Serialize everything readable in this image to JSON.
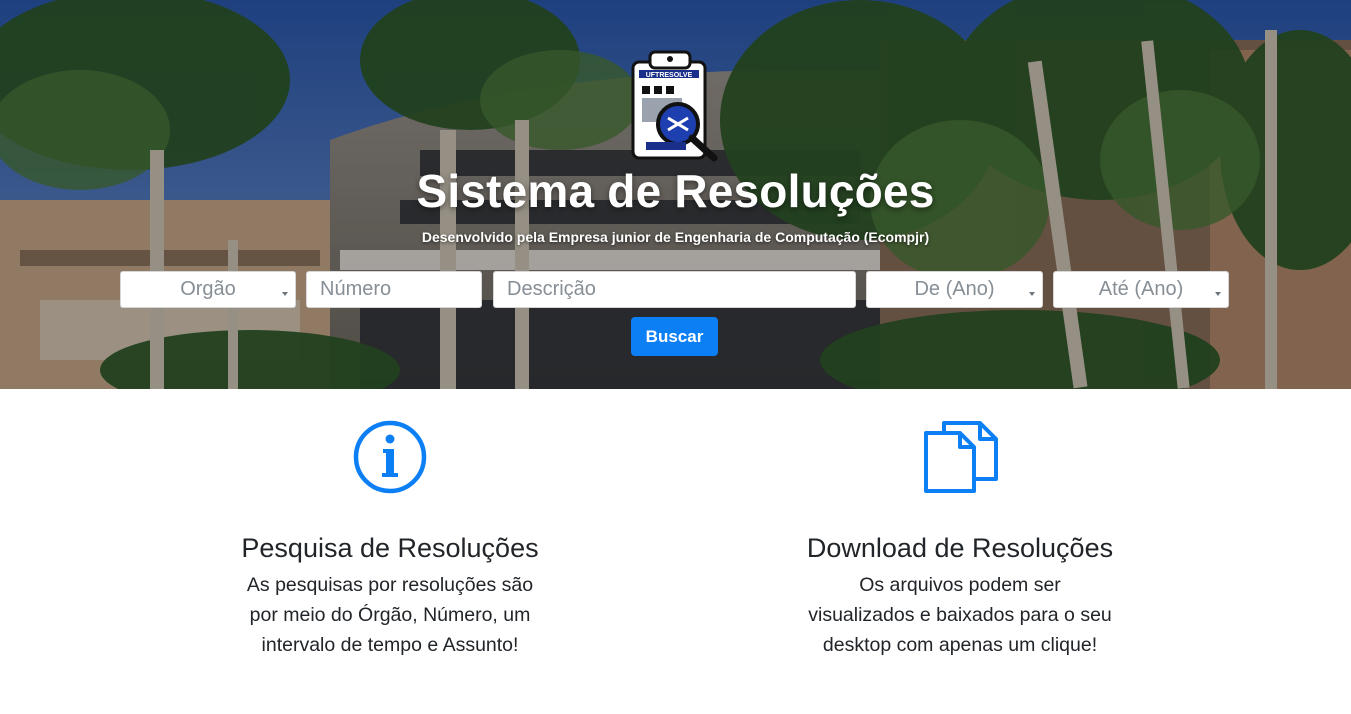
{
  "hero": {
    "title": "Sistema de Resoluções",
    "subtitle": "Desenvolvido pela Empresa junior de Engenharia de Computação (Ecompjr)",
    "logo_text": "UFTRESOLVE"
  },
  "search": {
    "orgao_placeholder": "Orgão",
    "numero_placeholder": "Número",
    "descricao_placeholder": "Descrição",
    "de_ano_placeholder": "De (Ano)",
    "ate_ano_placeholder": "Até (Ano)",
    "buscar_label": "Buscar"
  },
  "features": [
    {
      "icon": "info-circle-icon",
      "title": "Pesquisa de Resoluções",
      "text": "As pesquisas por resoluções são por meio do Órgão, Número, um intervalo de tempo e Assunto!"
    },
    {
      "icon": "documents-icon",
      "title": "Download de Resoluções",
      "text": "Os arquivos podem ser visualizados e baixados para o seu desktop com apenas um clique!"
    }
  ],
  "colors": {
    "accent": "#0d7ff5",
    "text": "#212529",
    "placeholder": "#868e96"
  }
}
